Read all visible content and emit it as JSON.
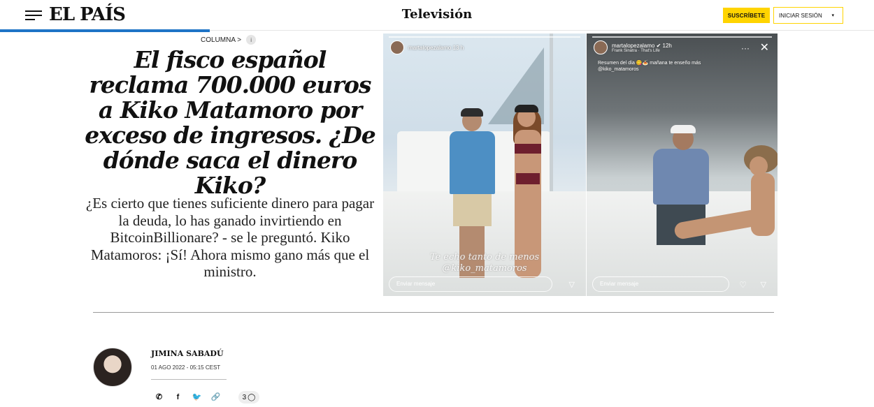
{
  "header": {
    "logo": "EL PAÍS",
    "section": "Televisión",
    "subscribe_label": "SUSCRÍBETE",
    "login_label": "INICIAR SESIÓN",
    "login_caret": "▾",
    "reading_progress": 0.24
  },
  "article": {
    "kicker": "COLUMNA >",
    "kicker_badge": "i",
    "headline": "El fisco español reclama 700.000 euros a Kiko Matamoro por exceso de ingresos. ¿De dónde saca el dinero Kiko?",
    "subheadline": "¿Es cierto que tienes suficiente dinero para pagar la deuda, lo has ganado invirtiendo en BitcoinBillionare? - se le preguntó. Kiko Matamoros: ¡Sí! Ahora mismo gano más que el ministro."
  },
  "photos": {
    "left": {
      "username": "martalopezalamo",
      "time": "13 h",
      "overlay_line1": "Te echo tanto de menos",
      "overlay_line2": "@kiko_matamoros",
      "input_placeholder": "Enviar mensaje",
      "send_icon": "send-icon"
    },
    "right": {
      "username": "martalopezalamo ✔ 12h",
      "song": "Frank Sinatra · That's Life",
      "caption_line1": "Resumen del día 😋🍝 mañana te enseño más",
      "caption_line2": "@kiko_matamoros",
      "dots": "···",
      "close": "✕",
      "input_placeholder": "Enviar mensaje",
      "heart": "♡",
      "send": "▽"
    }
  },
  "byline": {
    "author": "JIMINA SABADÚ",
    "date": "01 AGO 2022 - 05:15 CEST",
    "share_icons": [
      "whatsapp-icon",
      "facebook-icon",
      "twitter-icon",
      "link-icon"
    ],
    "share_glyphs": [
      "✆",
      "f",
      "🐦",
      "🔗"
    ],
    "comment_count": "3",
    "comment_glyph": "◯"
  }
}
